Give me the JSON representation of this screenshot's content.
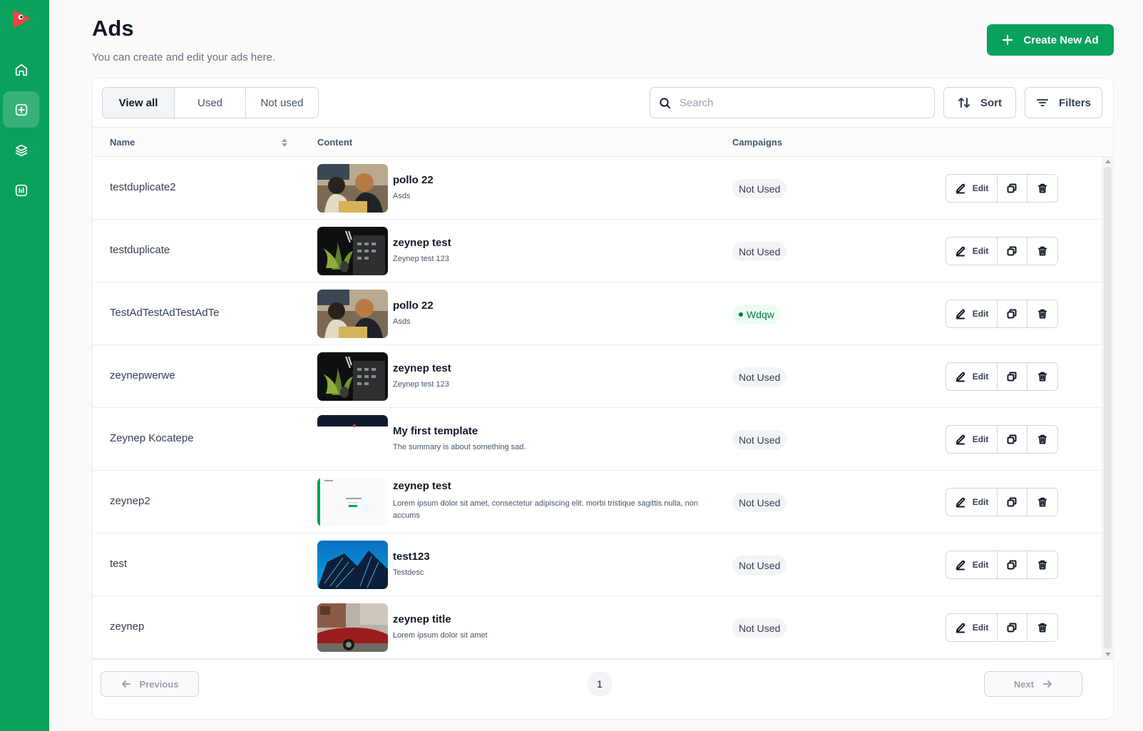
{
  "header": {
    "title": "Ads",
    "subtitle": "You can create and edit your ads here.",
    "create_label": "Create New Ad"
  },
  "sidebar": {
    "items": [
      {
        "icon": "home-icon"
      },
      {
        "icon": "plus-square-icon",
        "active": true
      },
      {
        "icon": "layers-icon"
      },
      {
        "icon": "chart-icon"
      }
    ]
  },
  "filters": {
    "tabs": [
      "View all",
      "Used",
      "Not used"
    ],
    "active_tab": "View all",
    "search_placeholder": "Search",
    "sort_label": "Sort",
    "filters_label": "Filters"
  },
  "table": {
    "columns": [
      "Name",
      "Content",
      "Campaigns"
    ],
    "edit_label": "Edit",
    "rows": [
      {
        "name": "testduplicate2",
        "title": "pollo 22",
        "desc": "Asds",
        "campaign": "Not Used",
        "used": false,
        "thumb": "kids"
      },
      {
        "name": "testduplicate",
        "title": "zeynep test",
        "desc": "Zeynep test 123",
        "campaign": "Not Used",
        "used": false,
        "thumb": "plant"
      },
      {
        "name": "TestAdTestAdTestAdTe",
        "title": "pollo 22",
        "desc": "Asds",
        "campaign": "Wdqw",
        "used": true,
        "thumb": "kids"
      },
      {
        "name": "zeynepwerwe",
        "title": "zeynep test",
        "desc": "Zeynep test 123",
        "campaign": "Not Used",
        "used": false,
        "thumb": "plant"
      },
      {
        "name": "Zeynep Kocatepe",
        "title": "My first template",
        "desc": "The summary is about something sad.",
        "campaign": "Not Used",
        "used": false,
        "thumb": "template"
      },
      {
        "name": "zeynep2",
        "title": "zeynep test",
        "desc": "Lorem ipsum dolor sit amet, consectetur adipiscing elit. morbi tristique sagittis nulla, non accums",
        "campaign": "Not Used",
        "used": false,
        "thumb": "screenshot"
      },
      {
        "name": "test",
        "title": "test123",
        "desc": "Testdesc",
        "campaign": "Not Used",
        "used": false,
        "thumb": "building"
      },
      {
        "name": "zeynep",
        "title": "zeynep title",
        "desc": "Lorem ipsum dolor sit amet",
        "campaign": "Not Used",
        "used": false,
        "thumb": "car"
      }
    ]
  },
  "pagination": {
    "previous_label": "Previous",
    "next_label": "Next",
    "current_page": "1"
  },
  "colors": {
    "brand": "#0aa15c",
    "used_badge_bg": "#ecfdf3",
    "used_badge_text": "#067647"
  }
}
